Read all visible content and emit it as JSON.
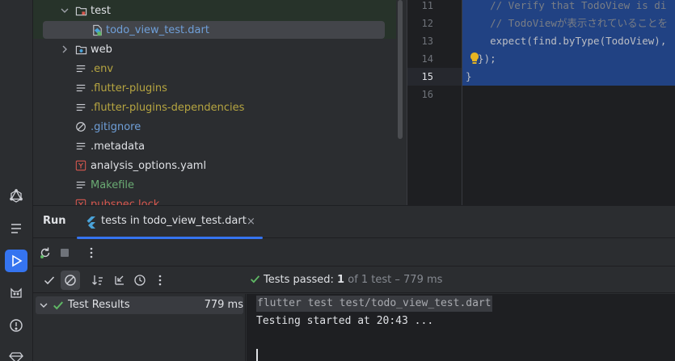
{
  "colors": {
    "accent": "#3574f0",
    "success": "#5fb865",
    "dart_blue": "#4aa3d9",
    "folder_red": "#d8584f",
    "vcs_yellow": "#b6a541",
    "vcs_blue": "#6f9fd8",
    "vcs_green": "#6aab73"
  },
  "tree": {
    "items": [
      {
        "label": "test",
        "icon": "folder-test-icon",
        "expanded": true,
        "color": "#dfe1e5"
      },
      {
        "label": "todo_view_test.dart",
        "icon": "dart-test-file-icon",
        "selected": true,
        "color": "#6f9fd8"
      },
      {
        "label": "web",
        "icon": "folder-icon",
        "expanded": false,
        "color": "#dfe1e5"
      },
      {
        "label": ".env",
        "icon": "text-file-icon",
        "color": "#b6a541"
      },
      {
        "label": ".flutter-plugins",
        "icon": "text-file-icon",
        "color": "#b6a541"
      },
      {
        "label": ".flutter-plugins-dependencies",
        "icon": "text-file-icon",
        "color": "#b6a541"
      },
      {
        "label": ".gitignore",
        "icon": "ignore-file-icon",
        "color": "#6f9fd8"
      },
      {
        "label": ".metadata",
        "icon": "text-file-icon",
        "color": "#dfe1e5"
      },
      {
        "label": "analysis_options.yaml",
        "icon": "yaml-file-icon",
        "color": "#dfe1e5"
      },
      {
        "label": "Makefile",
        "icon": "text-file-icon",
        "color": "#6aab73"
      },
      {
        "label": "pubspec.lock",
        "icon": "yaml-file-icon",
        "color": "#d8584f"
      }
    ]
  },
  "editor": {
    "lines": [
      {
        "num": "11",
        "code": "    // Verify that TodoView is di",
        "comment": true
      },
      {
        "num": "12",
        "code": "    // TodoViewが表示されていることを",
        "comment": true
      },
      {
        "num": "13",
        "code": "    expect(find.byType(TodoView),",
        "comment": false
      },
      {
        "num": "14",
        "code": "  });",
        "comment": false
      },
      {
        "num": "15",
        "code": "}",
        "comment": false
      },
      {
        "num": "16",
        "code": "",
        "comment": false
      }
    ]
  },
  "run_panel": {
    "title": "Run",
    "tab_label": "tests in todo_view_test.dart",
    "tab_close": "×",
    "status": {
      "label": "Tests passed:",
      "count": "1",
      "detail": "of 1 test – 779 ms"
    },
    "results": {
      "label": "Test Results",
      "time": "779 ms"
    },
    "console": {
      "command": "flutter test test/todo_view_test.dart",
      "output": "Testing started at 20:43 ..."
    }
  }
}
